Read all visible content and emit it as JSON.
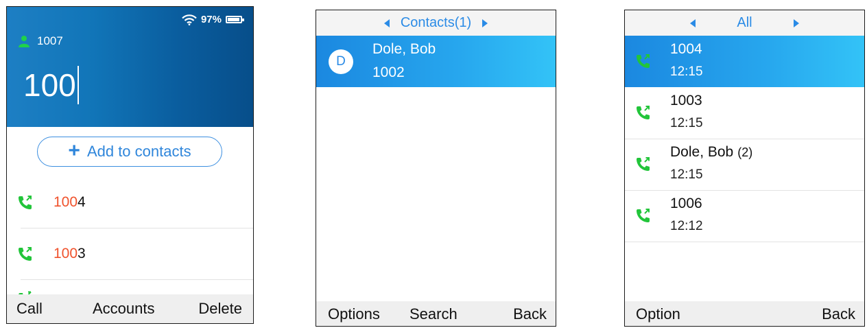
{
  "dialer": {
    "wifi_icon": "wifi-icon",
    "battery_percent_text": "97%",
    "battery_level": 0.97,
    "account_icon": "person-icon",
    "account_number": "1007",
    "dialed_number": "100",
    "add_contacts_label": "Add to contacts",
    "matches": [
      {
        "match": "100",
        "rest": "4",
        "icon": "outgoing-call-icon"
      },
      {
        "match": "100",
        "rest": "3",
        "icon": "outgoing-call-icon"
      }
    ],
    "softkeys": {
      "left": "Call",
      "middle": "Accounts",
      "right": "Delete"
    },
    "colors": {
      "header_start": "#1d7fc4",
      "header_end": "#074e8a",
      "match_highlight": "#f0522c",
      "accent": "#2f86db"
    }
  },
  "contacts": {
    "nav_title": "Contacts(1)",
    "items": [
      {
        "initial": "D",
        "name": "Dole, Bob",
        "number": "1002"
      }
    ],
    "softkeys": {
      "left": "Options",
      "middle": "Search",
      "right": "Back"
    }
  },
  "history": {
    "nav_title": "All",
    "items": [
      {
        "name": "1004",
        "count": "",
        "time": "12:15",
        "icon": "outgoing-call-icon"
      },
      {
        "name": "1003",
        "count": "",
        "time": "12:15",
        "icon": "outgoing-call-icon"
      },
      {
        "name": "Dole, Bob",
        "count": "(2)",
        "time": "12:15",
        "icon": "outgoing-call-icon"
      },
      {
        "name": "1006",
        "count": "",
        "time": "12:12",
        "icon": "outgoing-call-icon"
      }
    ],
    "softkeys": {
      "left": "Option",
      "right": "Back"
    },
    "colors": {
      "selected_start": "#1b88e0",
      "selected_end": "#33c3f7",
      "call_icon": "#22c53a"
    }
  }
}
